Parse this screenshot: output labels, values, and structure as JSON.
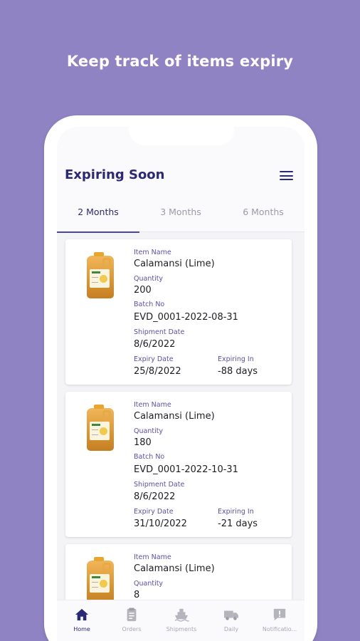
{
  "headline": "Keep track of items expiry",
  "app": {
    "title": "Expiring Soon",
    "tabs": [
      {
        "label": "2 Months",
        "active": true
      },
      {
        "label": "3 Months",
        "active": false
      },
      {
        "label": "6 Months",
        "active": false
      }
    ],
    "field_labels": {
      "item_name": "Item Name",
      "quantity": "Quantity",
      "batch_no": "Batch No",
      "shipment_date": "Shipment Date",
      "expiry_date": "Expiry Date",
      "expiring_in": "Expiring In"
    },
    "items": [
      {
        "name": "Calamansi (Lime)",
        "quantity": "200",
        "batch_no": "EVD_0001-2022-08-31",
        "shipment_date": "8/6/2022",
        "expiry_date": "25/8/2022",
        "expiring_in": "-88 days"
      },
      {
        "name": "Calamansi (Lime)",
        "quantity": "180",
        "batch_no": "EVD_0001-2022-10-31",
        "shipment_date": "8/6/2022",
        "expiry_date": "31/10/2022",
        "expiring_in": "-21 days"
      },
      {
        "name": "Calamansi (Lime)",
        "quantity": "8"
      }
    ],
    "bottom_nav": [
      {
        "label": "Home",
        "icon": "home-icon",
        "active": true
      },
      {
        "label": "Orders",
        "icon": "clipboard-icon",
        "active": false
      },
      {
        "label": "Shipments",
        "icon": "ship-icon",
        "active": false
      },
      {
        "label": "Daily",
        "icon": "truck-icon",
        "active": false
      },
      {
        "label": "Notificatio...",
        "icon": "alert-message-icon",
        "active": false
      }
    ],
    "colors": {
      "background": "#8f83c4",
      "primary": "#2c2878",
      "accent_label": "#5a4fb0",
      "inactive": "#a8a8b2"
    }
  }
}
